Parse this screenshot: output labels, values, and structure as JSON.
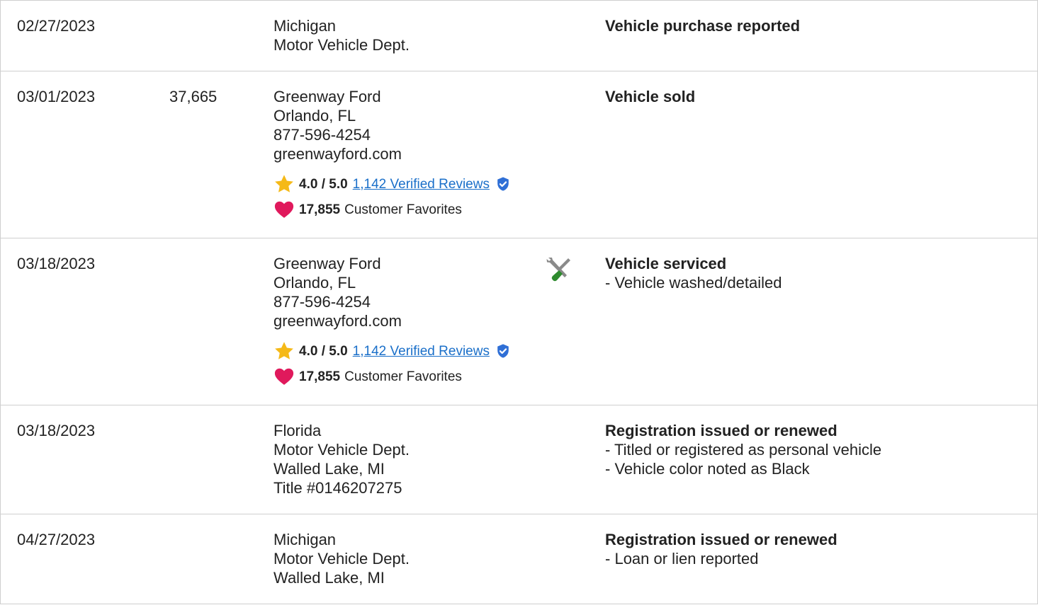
{
  "records": [
    {
      "date": "02/27/2023",
      "odometer": "",
      "source_lines": [
        "Michigan",
        "Motor Vehicle Dept."
      ],
      "has_rating": false,
      "has_icon": false,
      "event_title": "Vehicle purchase reported",
      "details": []
    },
    {
      "date": "03/01/2023",
      "odometer": "37,665",
      "source_lines": [
        "Greenway Ford",
        "Orlando, FL",
        "877-596-4254",
        "greenwayford.com"
      ],
      "has_rating": true,
      "rating": {
        "value": "4.0 / 5.0",
        "reviews_link": "1,142 Verified Reviews",
        "favorites_count": "17,855",
        "favorites_label": "Customer Favorites"
      },
      "has_icon": false,
      "event_title": "Vehicle sold",
      "details": []
    },
    {
      "date": "03/18/2023",
      "odometer": "",
      "source_lines": [
        "Greenway Ford",
        "Orlando, FL",
        "877-596-4254",
        "greenwayford.com"
      ],
      "has_rating": true,
      "rating": {
        "value": "4.0 / 5.0",
        "reviews_link": "1,142 Verified Reviews",
        "favorites_count": "17,855",
        "favorites_label": "Customer Favorites"
      },
      "has_icon": true,
      "icon": "wrench-screwdriver-icon",
      "event_title": "Vehicle serviced",
      "details": [
        "Vehicle washed/detailed"
      ]
    },
    {
      "date": "03/18/2023",
      "odometer": "",
      "source_lines": [
        "Florida",
        "Motor Vehicle Dept.",
        "Walled Lake, MI",
        "Title #0146207275"
      ],
      "has_rating": false,
      "has_icon": false,
      "event_title": "Registration issued or renewed",
      "details": [
        "Titled or registered as personal vehicle",
        "Vehicle color noted as Black"
      ]
    },
    {
      "date": "04/27/2023",
      "odometer": "",
      "source_lines": [
        "Michigan",
        "Motor Vehicle Dept.",
        "Walled Lake, MI"
      ],
      "has_rating": false,
      "has_icon": false,
      "event_title": "Registration issued or renewed",
      "details": [
        "Loan or lien reported"
      ]
    }
  ],
  "colors": {
    "star": "#f5b918",
    "heart": "#e0195c",
    "link": "#1a6fc9",
    "verified_badge": "#2f6fd6",
    "border": "#cfcfcf",
    "text": "#222222"
  }
}
